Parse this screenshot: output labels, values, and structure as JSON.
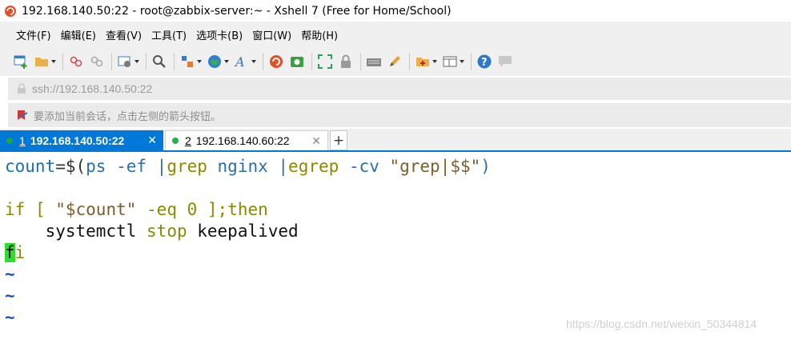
{
  "window": {
    "title": "192.168.140.50:22 - root@zabbix-server:~ - Xshell 7 (Free for Home/School)"
  },
  "menu": {
    "items": [
      "文件(F)",
      "编辑(E)",
      "查看(V)",
      "工具(T)",
      "选项卡(B)",
      "窗口(W)",
      "帮助(H)"
    ]
  },
  "address": {
    "value": "ssh://192.168.140.50:22"
  },
  "hint": {
    "text": "要添加当前会话，点击左侧的箭头按钮。"
  },
  "tabs": [
    {
      "number": "1",
      "label": "192.168.140.50:22",
      "active": true,
      "close": "✕"
    },
    {
      "number": "2",
      "label": "192.168.140.60:22",
      "active": false,
      "close": "✕"
    }
  ],
  "new_tab": "+",
  "terminal": {
    "line1": {
      "var": "count",
      "eq": "=$(",
      "ps": "ps -ef |",
      "grep": "grep",
      "nginx": " nginx |",
      "egrep": "egrep",
      "opts": " -cv ",
      "str": "\"grep|$$\"",
      "end": ")"
    },
    "line2": {
      "if": "if",
      "br": " [ ",
      "str": "\"$count\"",
      "op": " -eq 0 ];",
      "then": "then"
    },
    "line3": {
      "indent": "    ",
      "cmd": "systemctl",
      "sp": " ",
      "stop": "stop",
      "svc": " keepalived"
    },
    "line4": {
      "cursor_char": "f",
      "rest": "i"
    },
    "tilde": "~"
  },
  "watermark": "https://blog.csdn.net/weixin_50344814",
  "colors": {
    "accent": "#0078d7",
    "cursor": "#2ae02a",
    "session_dot": "#22b14c"
  }
}
